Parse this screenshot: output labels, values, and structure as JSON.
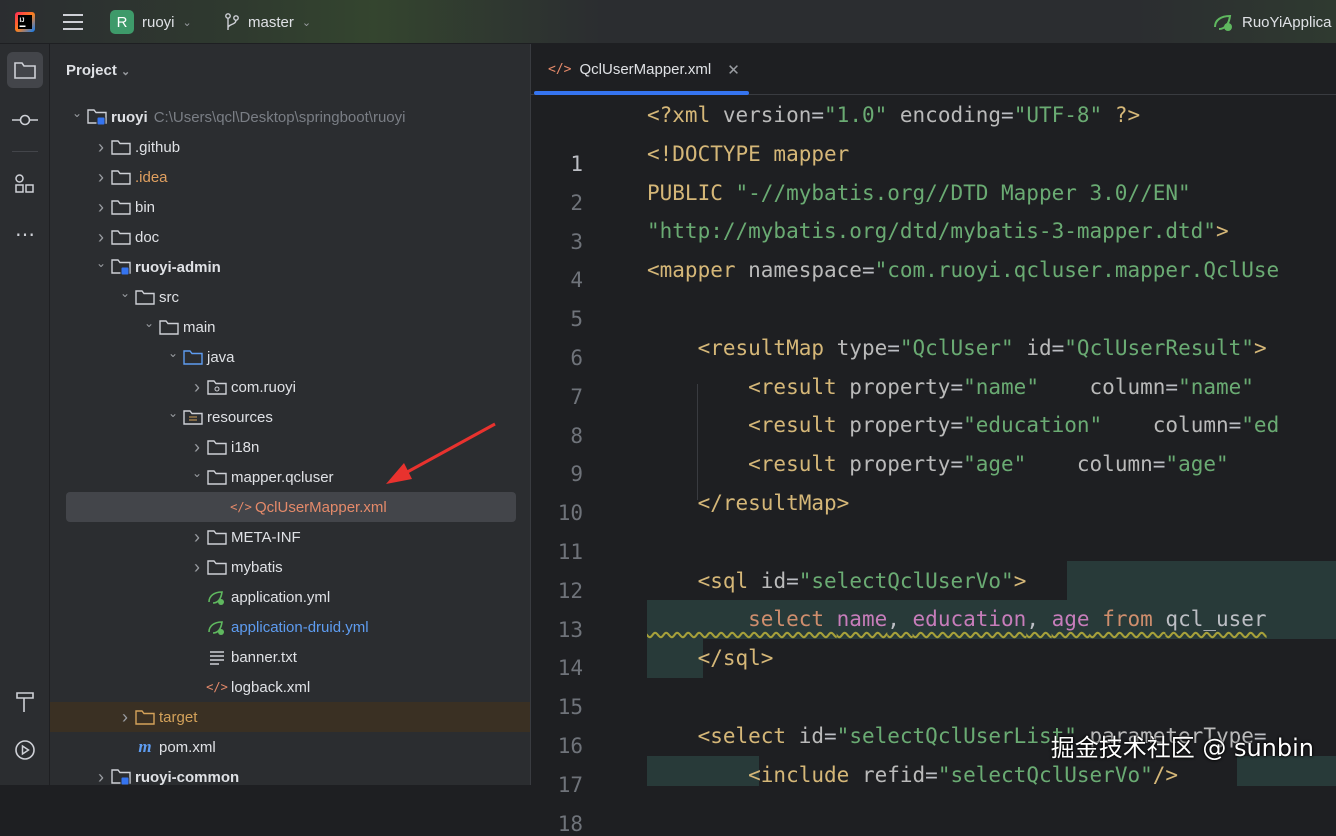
{
  "topbar": {
    "project_badge": "R",
    "project": "ruoyi",
    "branch": "master",
    "run_config": "RuoYiApplica"
  },
  "project_panel": {
    "title": "Project",
    "rows": [
      {
        "depth": 0,
        "chev": "down",
        "icon": "module",
        "label": "ruoyi",
        "bold": true,
        "hint": "C:\\Users\\qcl\\Desktop\\springboot\\ruoyi"
      },
      {
        "depth": 1,
        "chev": "right",
        "icon": "folder",
        "label": ".github"
      },
      {
        "depth": 1,
        "chev": "right",
        "icon": "folder",
        "label": ".idea",
        "color": "#e0a060"
      },
      {
        "depth": 1,
        "chev": "right",
        "icon": "folder",
        "label": "bin"
      },
      {
        "depth": 1,
        "chev": "right",
        "icon": "folder",
        "label": "doc"
      },
      {
        "depth": 1,
        "chev": "down",
        "icon": "module",
        "label": "ruoyi-admin",
        "bold": true
      },
      {
        "depth": 2,
        "chev": "down",
        "icon": "folder",
        "label": "src"
      },
      {
        "depth": 3,
        "chev": "down",
        "icon": "folder",
        "label": "main"
      },
      {
        "depth": 4,
        "chev": "down",
        "icon": "folder-blue",
        "label": "java"
      },
      {
        "depth": 5,
        "chev": "right",
        "icon": "package",
        "label": "com.ruoyi"
      },
      {
        "depth": 4,
        "chev": "down",
        "icon": "resources",
        "label": "resources"
      },
      {
        "depth": 5,
        "chev": "right",
        "icon": "folder",
        "label": "i18n"
      },
      {
        "depth": 5,
        "chev": "down",
        "icon": "folder",
        "label": "mapper.qcluser"
      },
      {
        "depth": 6,
        "chev": "none",
        "icon": "xml",
        "label": "QclUserMapper.xml",
        "color": "#e58a6a",
        "selected": true
      },
      {
        "depth": 5,
        "chev": "right",
        "icon": "folder",
        "label": "META-INF"
      },
      {
        "depth": 5,
        "chev": "right",
        "icon": "folder",
        "label": "mybatis"
      },
      {
        "depth": 5,
        "chev": "none",
        "icon": "spring",
        "label": "application.yml"
      },
      {
        "depth": 5,
        "chev": "none",
        "icon": "spring",
        "label": "application-druid.yml",
        "color": "#5e9cf0"
      },
      {
        "depth": 5,
        "chev": "none",
        "icon": "text",
        "label": "banner.txt"
      },
      {
        "depth": 5,
        "chev": "none",
        "icon": "xml",
        "label": "logback.xml"
      },
      {
        "depth": 2,
        "chev": "right",
        "icon": "folder-orange",
        "label": "target",
        "color": "#d4a25a",
        "target": true
      },
      {
        "depth": 2,
        "chev": "none",
        "icon": "maven",
        "label": "pom.xml"
      },
      {
        "depth": 1,
        "chev": "right",
        "icon": "module",
        "label": "ruoyi-common",
        "bold": true
      }
    ]
  },
  "editor": {
    "tab_label": "QclUserMapper.xml",
    "lines": [
      {
        "n": "1",
        "t": [
          [
            "<?xml ",
            "tag"
          ],
          [
            "version",
            "attr"
          ],
          [
            "=",
            "txt"
          ],
          [
            "\"1.0\"",
            "str"
          ],
          [
            " encoding",
            "attr"
          ],
          [
            "=",
            "txt"
          ],
          [
            "\"UTF-8\"",
            "str"
          ],
          [
            " ?>",
            "tag"
          ]
        ]
      },
      {
        "n": "2",
        "t": [
          [
            "<!DOCTYPE mapper",
            "tag"
          ]
        ]
      },
      {
        "n": "3",
        "t": [
          [
            "PUBLIC ",
            "tag"
          ],
          [
            "\"-//mybatis.org//DTD Mapper 3.0//EN\"",
            "str"
          ]
        ]
      },
      {
        "n": "4",
        "t": [
          [
            "\"http://mybatis.org/dtd/mybatis-3-mapper.dtd\"",
            "str"
          ],
          [
            ">",
            "tag"
          ]
        ]
      },
      {
        "n": "5",
        "t": [
          [
            "<mapper ",
            "tag"
          ],
          [
            "namespace",
            "attr"
          ],
          [
            "=",
            "txt"
          ],
          [
            "\"com.ruoyi.qcluser.mapper.QclUse",
            "str"
          ]
        ]
      },
      {
        "n": "6",
        "t": []
      },
      {
        "n": "7",
        "t": [
          [
            "    <resultMap ",
            "tag"
          ],
          [
            "type",
            "attr"
          ],
          [
            "=",
            "txt"
          ],
          [
            "\"QclUser\"",
            "str"
          ],
          [
            " id",
            "attr"
          ],
          [
            "=",
            "txt"
          ],
          [
            "\"QclUserResult\"",
            "str"
          ],
          [
            ">",
            "tag"
          ]
        ]
      },
      {
        "n": "8",
        "t": [
          [
            "        <result ",
            "tag"
          ],
          [
            "property",
            "attr"
          ],
          [
            "=",
            "txt"
          ],
          [
            "\"name\"",
            "str"
          ],
          [
            "    column",
            "attr"
          ],
          [
            "=",
            "txt"
          ],
          [
            "\"name\"",
            "str"
          ]
        ]
      },
      {
        "n": "9",
        "t": [
          [
            "        <result ",
            "tag"
          ],
          [
            "property",
            "attr"
          ],
          [
            "=",
            "txt"
          ],
          [
            "\"education\"",
            "str"
          ],
          [
            "    column",
            "attr"
          ],
          [
            "=",
            "txt"
          ],
          [
            "\"ed",
            "str"
          ]
        ]
      },
      {
        "n": "10",
        "t": [
          [
            "        <result ",
            "tag"
          ],
          [
            "property",
            "attr"
          ],
          [
            "=",
            "txt"
          ],
          [
            "\"age\"",
            "str"
          ],
          [
            "    column",
            "attr"
          ],
          [
            "=",
            "txt"
          ],
          [
            "\"age\"",
            "str"
          ]
        ]
      },
      {
        "n": "11",
        "t": [
          [
            "    </resultMap>",
            "tag"
          ]
        ]
      },
      {
        "n": "12",
        "t": []
      },
      {
        "n": "13",
        "t": [
          [
            "    <sql ",
            "tag"
          ],
          [
            "id",
            "attr"
          ],
          [
            "=",
            "txt"
          ],
          [
            "\"selectQclUserVo\"",
            "str"
          ],
          [
            ">",
            "tag"
          ]
        ]
      },
      {
        "n": "14",
        "t": [
          [
            "        select ",
            "kw"
          ],
          [
            "name",
            "col"
          ],
          [
            ", ",
            "txt"
          ],
          [
            "education",
            "col"
          ],
          [
            ", ",
            "txt"
          ],
          [
            "age",
            "col"
          ],
          [
            " from ",
            "kw"
          ],
          [
            "qcl_user",
            "txt"
          ]
        ]
      },
      {
        "n": "15",
        "t": [
          [
            "    </sql>",
            "tag"
          ]
        ]
      },
      {
        "n": "16",
        "t": []
      },
      {
        "n": "17",
        "t": [
          [
            "    <select ",
            "tag"
          ],
          [
            "id",
            "attr"
          ],
          [
            "=",
            "txt"
          ],
          [
            "\"selectQclUserList\"",
            "str"
          ],
          [
            " parameterType",
            "attr"
          ],
          [
            "=",
            "txt"
          ]
        ]
      },
      {
        "n": "18",
        "t": [
          [
            "        <include ",
            "tag"
          ],
          [
            "refid",
            "attr"
          ],
          [
            "=",
            "txt"
          ],
          [
            "\"selectQclUserVo\"",
            "str"
          ],
          [
            "/>",
            "tag"
          ]
        ]
      }
    ]
  },
  "watermark": "掘金技术社区 @ sunbin",
  "colors": {
    "accent": "#3574f0",
    "selection": "#43454a",
    "annotation_arrow": "#e8322e"
  }
}
